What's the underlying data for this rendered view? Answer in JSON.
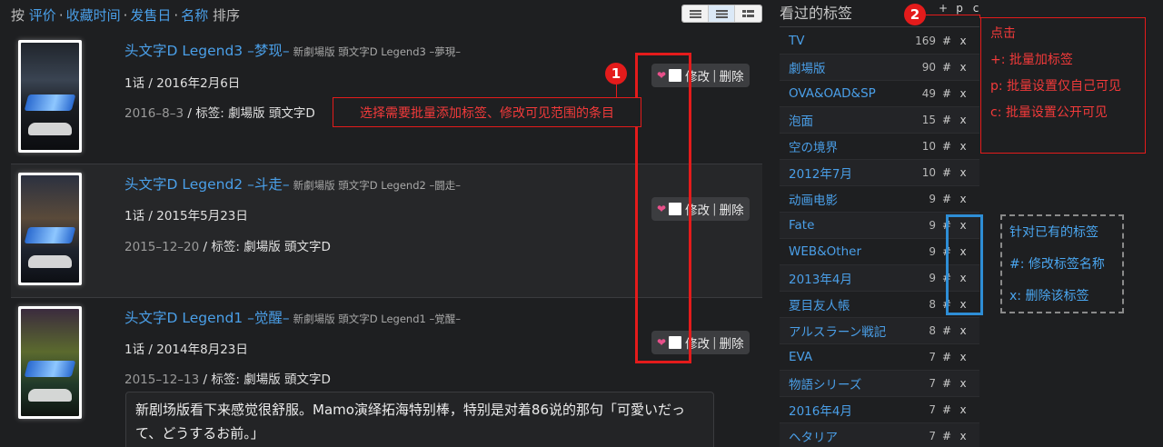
{
  "sortbar": {
    "prefix": "按",
    "options": [
      "评价",
      "收藏时间",
      "发售日",
      "名称"
    ],
    "suffix": "排序",
    "separator": "·"
  },
  "view_modes": [
    "list-icon",
    "detail-list-icon",
    "grid-icon"
  ],
  "items": [
    {
      "title": "头文字D Legend3 –梦现–",
      "original_title": "新劇場版 頭文字D Legend3 –夢現–",
      "episodes": "1话",
      "release_date": "2016年2月6日",
      "collect_date": "2016–8–3",
      "tags_label": "标签:",
      "tags": "劇場版 頭文字D"
    },
    {
      "title": "头文字D Legend2 –斗走–",
      "original_title": "新劇場版 頭文字D Legend2 –闘走–",
      "episodes": "1话",
      "release_date": "2015年5月23日",
      "collect_date": "2015–12–20",
      "tags_label": "标签:",
      "tags": "劇場版 頭文字D"
    },
    {
      "title": "头文字D Legend1 –觉醒–",
      "original_title": "新劇場版 頭文字D Legend1 –覚醒–",
      "episodes": "1话",
      "release_date": "2014年8月23日",
      "collect_date": "2015–12–13",
      "tags_label": "标签:",
      "tags": "劇場版 頭文字D",
      "comment": "新剧场版看下来感觉很舒服。Mamo演绎拓海特别棒，特别是对着86说的那句「可愛いだって、どうするお前。」"
    }
  ],
  "item_actions": {
    "edit": "修改",
    "delete": "删除",
    "pipe": "|"
  },
  "slash": "/",
  "tags_panel": {
    "title": "看过的标签",
    "actions": [
      "+",
      "p",
      "c"
    ],
    "hash": "#",
    "del": "x",
    "tags": [
      {
        "name": "TV",
        "count": "169"
      },
      {
        "name": "劇場版",
        "count": "90"
      },
      {
        "name": "OVA&OAD&SP",
        "count": "49"
      },
      {
        "name": "泡面",
        "count": "15"
      },
      {
        "name": "空の境界",
        "count": "10"
      },
      {
        "name": "2012年7月",
        "count": "10"
      },
      {
        "name": "动画电影",
        "count": "9"
      },
      {
        "name": "Fate",
        "count": "9"
      },
      {
        "name": "WEB&Other",
        "count": "9"
      },
      {
        "name": "2013年4月",
        "count": "9"
      },
      {
        "name": "夏目友人帳",
        "count": "8"
      },
      {
        "name": "アルスラーン戦記",
        "count": "8"
      },
      {
        "name": "EVA",
        "count": "7"
      },
      {
        "name": "物語シリーズ",
        "count": "7"
      },
      {
        "name": "2016年4月",
        "count": "7"
      },
      {
        "name": "ヘタリア",
        "count": "7"
      }
    ]
  },
  "annotations": {
    "marker1": "1",
    "marker2": "2",
    "callout1": "选择需要批量添加标签、修改可见范围的条目",
    "callout2": [
      "点击",
      "+: 批量加标签",
      "p: 批量设置仅自己可见",
      "c: 批量设置公开可见"
    ],
    "callout3": [
      "针对已有的标签",
      "#: 修改标签名称",
      "x: 删除该标签"
    ],
    "colors": {
      "red": "#e41b1b",
      "blue": "#2e8ed6",
      "link": "#4a9fe8"
    }
  }
}
